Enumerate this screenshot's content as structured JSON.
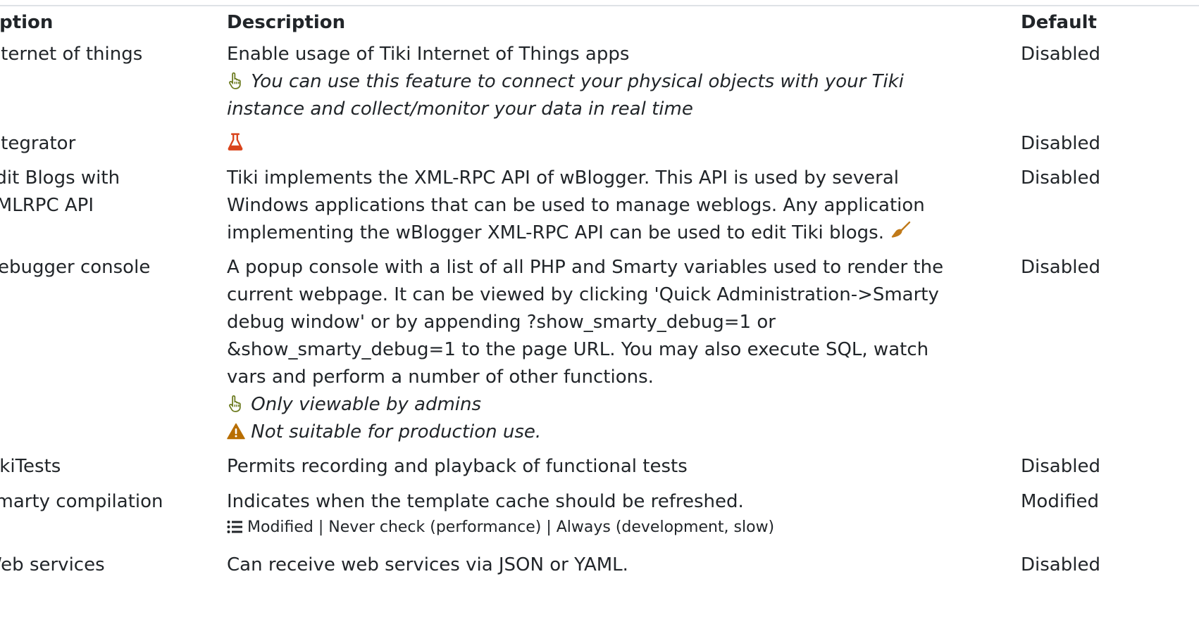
{
  "table": {
    "headers": {
      "option": "Option",
      "description": "Description",
      "default": "Default"
    },
    "rows": [
      {
        "option": "Internet of things",
        "description": "Enable usage of Tiki Internet of Things apps",
        "note_lines": [
          "You can use this feature to connect your physical objects with your Tiki",
          "instance and collect/monitor your data in real time"
        ],
        "note_icon": "pointing-hand-icon",
        "default": "Disabled"
      },
      {
        "option": "Integrator",
        "description": "",
        "description_icon": "flask-experimental-icon",
        "default": "Disabled"
      },
      {
        "option_lines": [
          "Edit Blogs with",
          "XMLRPC API"
        ],
        "description_lines": [
          "Tiki implements the XML-RPC API of wBlogger. This API is used by several",
          "Windows applications that can be used to manage weblogs. Any application",
          "implementing the wBlogger XML-RPC API can be used to edit Tiki blogs."
        ],
        "description_icon": "broom-icon",
        "default": "Disabled"
      },
      {
        "option": "Debugger console",
        "description_lines": [
          "A popup console with a list of all PHP and Smarty variables used to render the",
          "current webpage. It can be viewed by clicking 'Quick Administration->Smarty",
          "debug window' or by appending ?show_smarty_debug=1 or",
          "&show_smarty_debug=1 to the page URL. You may also execute SQL, watch",
          "vars and perform a number of other functions."
        ],
        "note_admin": "Only viewable by admins",
        "note_admin_icon": "pointing-hand-icon",
        "note_warning": "Not suitable for production use.",
        "note_warning_icon": "warning-icon",
        "default": "Disabled"
      },
      {
        "option": "TikiTests",
        "description": "Permits recording and playback of functional tests",
        "default": "Disabled"
      },
      {
        "option": "Smarty compilation",
        "description": "Indicates when the template cache should be refreshed.",
        "options_list": "Modified | Never check (performance) | Always (development, slow)",
        "options_icon": "list-icon",
        "default": "Modified"
      },
      {
        "option": "Web services",
        "description": "Can receive web services via JSON or YAML.",
        "default": "Disabled"
      }
    ]
  },
  "colors": {
    "text": "#212529",
    "hand_icon": "#6b7a1e",
    "flask_icon": "#d9441c",
    "broom_icon": "#c07a1a",
    "warning_icon": "#b86e00",
    "rule": "#dee2e6"
  }
}
